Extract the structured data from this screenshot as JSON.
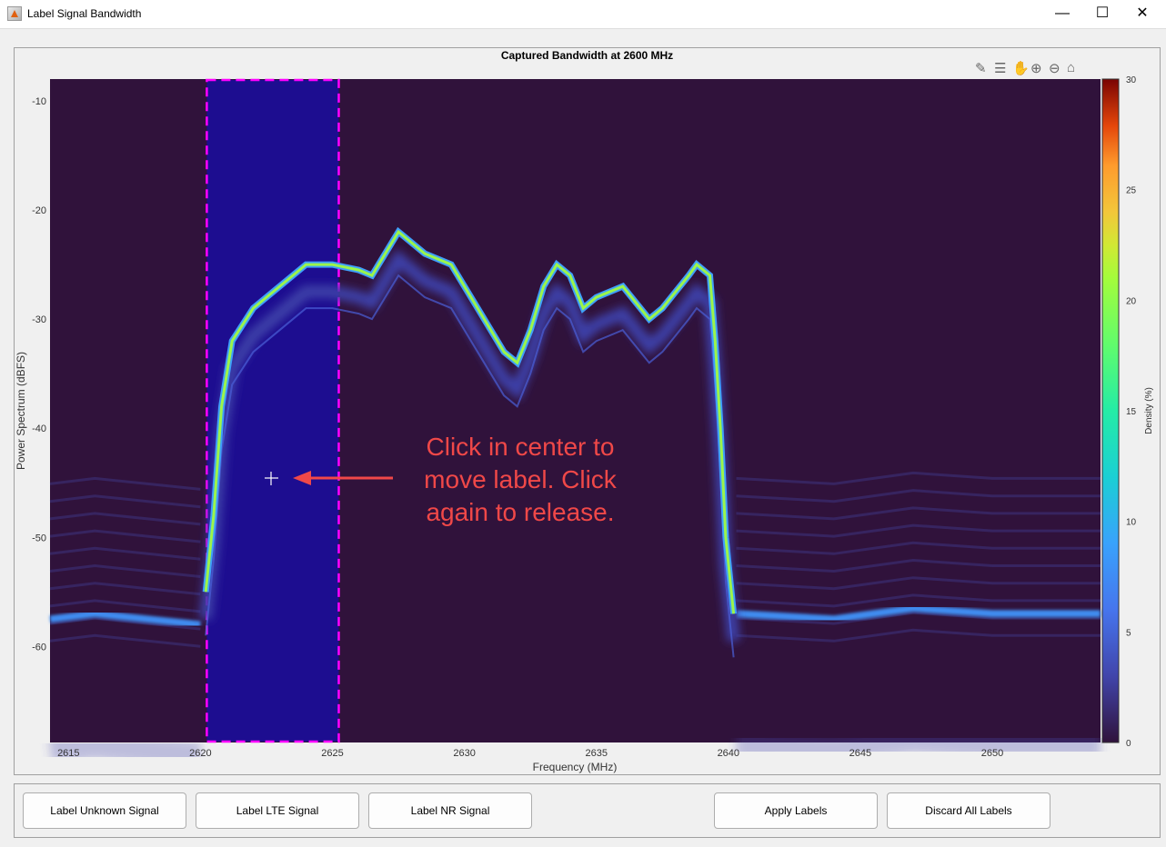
{
  "window": {
    "title": "Label Signal Bandwidth",
    "minimize": "—",
    "maximize": "☐",
    "close": "✕"
  },
  "toolbar": [
    "brush-icon",
    "legend-icon",
    "pan-icon",
    "zoom-in-icon",
    "zoom-out-icon",
    "home-icon"
  ],
  "annotation": "Click in center to move label. Click again to release.",
  "buttons": {
    "unknown": "Label Unknown Signal",
    "lte": "Label LTE Signal",
    "nr": "Label NR Signal",
    "apply": "Apply Labels",
    "discard": "Discard All Labels"
  },
  "colors": {
    "background": "#30123b",
    "label_fill": "#1a0da0",
    "label_border": "#ff00ff",
    "annotation": "#f04848"
  },
  "chart_data": {
    "type": "heatmap",
    "title": "Captured Bandwidth at 2600 MHz",
    "xlabel": "Frequency (MHz)",
    "ylabel": "Power Spectrum (dBFS)",
    "xlim": [
      2614.3,
      2654.1
    ],
    "ylim": [
      -68.8,
      -8
    ],
    "xticks": [
      2615,
      2620,
      2625,
      2630,
      2635,
      2640,
      2645,
      2650
    ],
    "yticks": [
      -10,
      -20,
      -30,
      -40,
      -50,
      -60
    ],
    "colorbar": {
      "label": "Density (%)",
      "range": [
        0,
        30
      ],
      "ticks": [
        0,
        5,
        10,
        15,
        20,
        25,
        30
      ]
    },
    "label_region": {
      "start_mhz": 2620.24,
      "end_mhz": 2625.24
    },
    "main_trace": [
      [
        2620.2,
        -55
      ],
      [
        2620.5,
        -48
      ],
      [
        2620.8,
        -38
      ],
      [
        2621.2,
        -32
      ],
      [
        2622,
        -29
      ],
      [
        2623,
        -27
      ],
      [
        2624,
        -25
      ],
      [
        2625,
        -25
      ],
      [
        2626,
        -25.5
      ],
      [
        2626.5,
        -26
      ],
      [
        2627.5,
        -22
      ],
      [
        2628.5,
        -24
      ],
      [
        2629.5,
        -25
      ],
      [
        2630.5,
        -29
      ],
      [
        2631.5,
        -33
      ],
      [
        2632,
        -34
      ],
      [
        2632.5,
        -31
      ],
      [
        2633,
        -27
      ],
      [
        2633.5,
        -25
      ],
      [
        2634,
        -26
      ],
      [
        2634.5,
        -29
      ],
      [
        2635,
        -28
      ],
      [
        2636,
        -27
      ],
      [
        2637,
        -30
      ],
      [
        2637.5,
        -29
      ],
      [
        2638,
        -27.5
      ],
      [
        2638.5,
        -26
      ],
      [
        2638.8,
        -25
      ],
      [
        2639.3,
        -26
      ],
      [
        2639.5,
        -32
      ],
      [
        2639.7,
        -40
      ],
      [
        2639.9,
        -50
      ],
      [
        2640.2,
        -57
      ]
    ],
    "noise_floor": [
      [
        2614.3,
        -57.5
      ],
      [
        2616,
        -57
      ],
      [
        2618,
        -57.5
      ],
      [
        2620,
        -58
      ],
      [
        2640.3,
        -57
      ],
      [
        2644,
        -57.5
      ],
      [
        2647,
        -56.5
      ],
      [
        2650,
        -57
      ],
      [
        2654.1,
        -57
      ]
    ]
  }
}
